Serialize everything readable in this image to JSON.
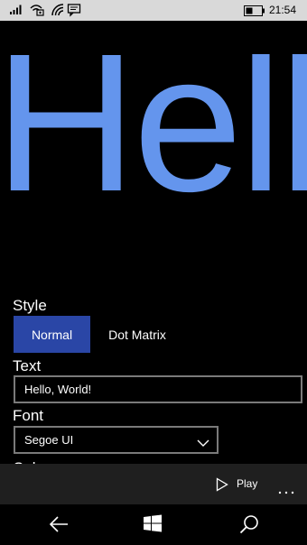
{
  "status_bar": {
    "time": "21:54",
    "icons": [
      "signal-icon",
      "wifi-call-icon",
      "wifi-icon",
      "message-icon",
      "battery-icon"
    ]
  },
  "marquee": {
    "text": "Hell"
  },
  "style_section": {
    "label": "Style",
    "options": [
      "Normal",
      "Dot Matrix"
    ],
    "selected": "Normal"
  },
  "text_section": {
    "label": "Text",
    "value": "Hello, World!"
  },
  "font_section": {
    "label": "Font",
    "selected": "Segoe UI"
  },
  "color_section": {
    "label": "Color"
  },
  "command_bar": {
    "play_label": "Play"
  },
  "colors": {
    "accent": "#2a46a6",
    "marquee_text": "#6495ed",
    "status_bar_bg": "#d9d9d9",
    "command_bar_bg": "#1f1f1f"
  },
  "nav_bar": {
    "icons": [
      "back-arrow-icon",
      "windows-logo-icon",
      "search-icon"
    ]
  }
}
